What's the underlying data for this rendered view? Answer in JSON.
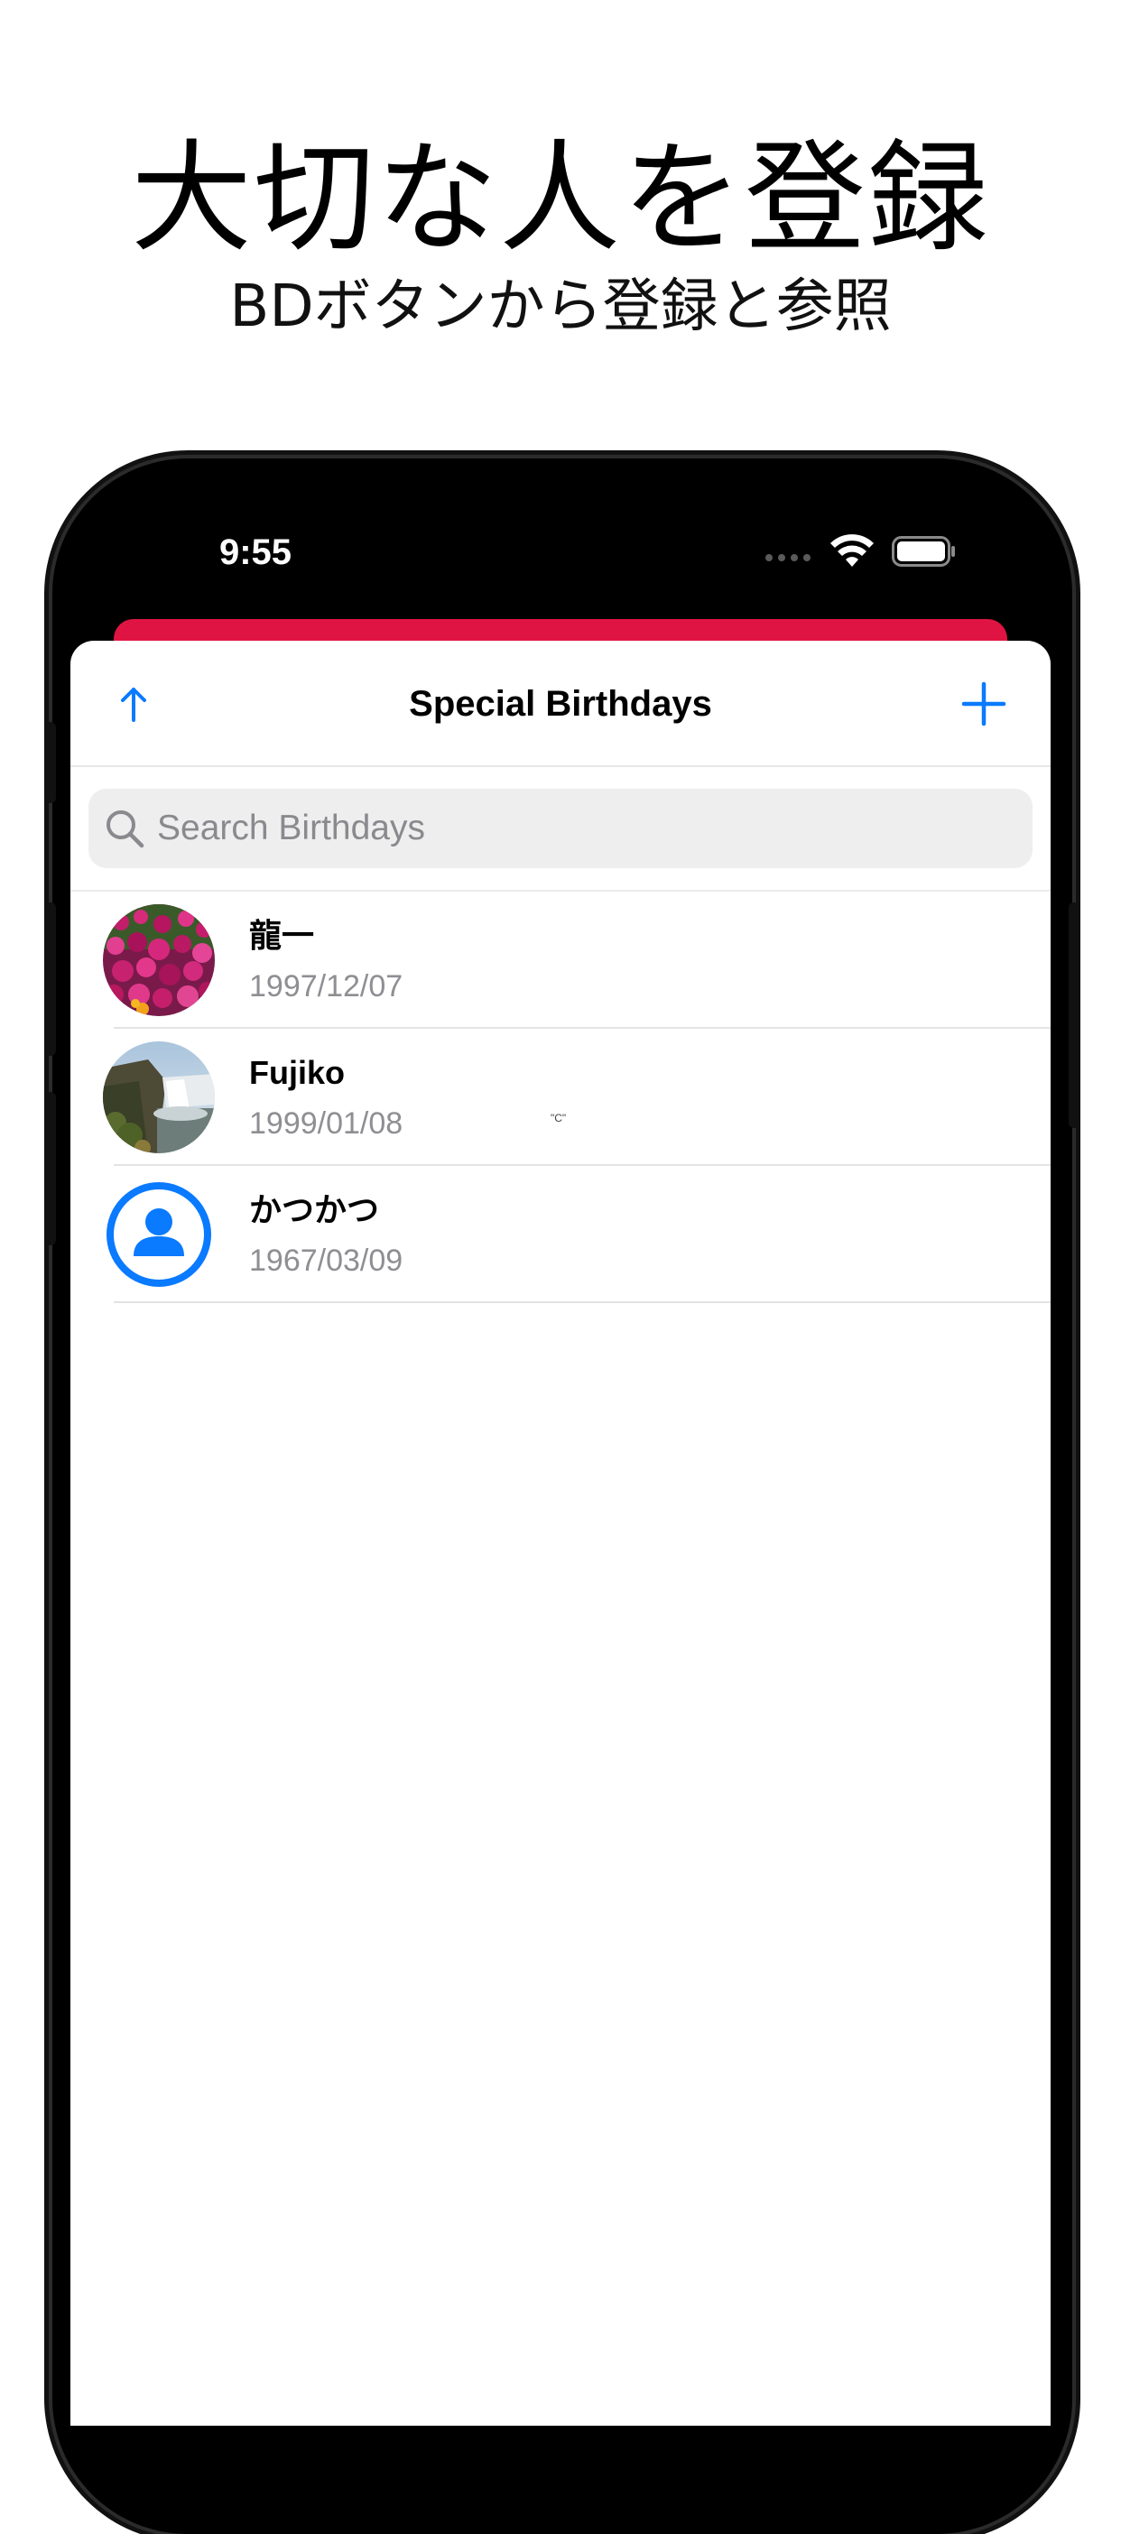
{
  "promo": {
    "title": "大切な人を登録",
    "subtitle": "BDボタンから登録と参照"
  },
  "status_bar": {
    "time": "9:55"
  },
  "nav": {
    "title": "Special Birthdays",
    "up_icon": "arrow-up-icon",
    "add_icon": "plus-icon"
  },
  "search": {
    "placeholder": "Search Birthdays",
    "value": ""
  },
  "birthdays": [
    {
      "name": "龍一",
      "date": "1997/12/07",
      "avatar": "flower-photo",
      "note": ""
    },
    {
      "name": "Fujiko",
      "date": "1999/01/08",
      "avatar": "waterfall-photo",
      "note": "\"C\""
    },
    {
      "name": "かつかつ",
      "date": "1967/03/09",
      "avatar": "person-icon",
      "note": ""
    }
  ],
  "colors": {
    "accent": "#0a7aff",
    "header_red": "#e01442",
    "secondary_text": "#8e8e93"
  }
}
